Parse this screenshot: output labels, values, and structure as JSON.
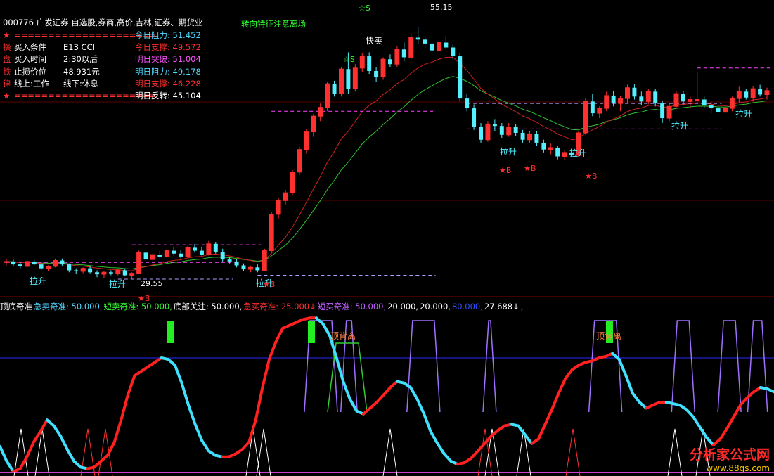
{
  "header": {
    "code": "000776",
    "name": "广发证券",
    "tags": "自选股,券商,高价,吉林,证券、期货业",
    "hint": "转向特征注意离场"
  },
  "info_panel": {
    "rows": [
      {
        "mark": "★",
        "label": "=====================",
        "key": "今日阻力:",
        "value": "51.452",
        "key_color": "#4fd8ff",
        "val_color": "#4fd8ff"
      },
      {
        "mark": "操",
        "label": "买入条件",
        "mid": "E13 CCI",
        "key": "今日支撑:",
        "value": "49.572",
        "key_color": "#ff3030",
        "val_color": "#ff3030"
      },
      {
        "mark": "盘",
        "label": "买入时间",
        "mid": "2:30以后",
        "key": "明日突破:",
        "value": "51.004",
        "key_color": "#ff55ff",
        "val_color": "#ff55ff"
      },
      {
        "mark": "铁",
        "label": "止损价位",
        "mid": "48.931元",
        "key": "明日阻力:",
        "value": "49.178",
        "key_color": "#4fd8ff",
        "val_color": "#4fd8ff"
      },
      {
        "mark": "律",
        "label": "线上:工作",
        "mid": "线下:休息",
        "key": "明日支撑:",
        "value": "46.228",
        "key_color": "#ff3030",
        "val_color": "#ff3030"
      },
      {
        "mark": "★",
        "label": "=====================",
        "key": "明日反转:",
        "value": "45.104",
        "key_color": "#ffffff",
        "val_color": "#ffffff"
      }
    ]
  },
  "annotations": {
    "sell_fast": "快卖",
    "peak_price": "55.15",
    "low_price": "29.55",
    "pull_up": "拉升",
    "buy": "★B",
    "sell": "☆S",
    "top_divergence": "顶背离"
  },
  "indicator_bar": {
    "items": [
      {
        "text": "顶底奇准",
        "color": "#ffffff"
      },
      {
        "text": "急卖奇准: 50.000,",
        "color": "#4fd8ff"
      },
      {
        "text": "短卖奇准: 50.000,",
        "color": "#33ff33"
      },
      {
        "text": "底部关注: 50.000,",
        "color": "#ffffff"
      },
      {
        "text": "急买奇准: 25.000↓",
        "color": "#ff3030"
      },
      {
        "text": "短买奇准: 50.000,",
        "color": "#c060ff"
      },
      {
        "text": "20.000,",
        "color": "#ffffff"
      },
      {
        "text": "20.000,",
        "color": "#ffffff"
      },
      {
        "text": "80.000,",
        "color": "#3050ff"
      },
      {
        "text": "27.688↓",
        "color": "#ffffff"
      },
      {
        "text": ",",
        "color": "#ffffff"
      }
    ]
  },
  "watermark": {
    "title": "分析家公式网",
    "url": "www.88gs.com"
  },
  "colors": {
    "up": "#ff3030",
    "down": "#54f0ff",
    "ma_fast": "#d02020",
    "ma_slow": "#30c030",
    "magenta": "#ff44ff",
    "blue_line": "#2a2aff",
    "osc_red": "#ff2020",
    "osc_cyan": "#40e0ff",
    "green_block": "#22ee22",
    "purple": "#a070ff"
  },
  "chart_data": [
    {
      "type": "candlestick",
      "title": "",
      "ylim": [
        28.0,
        56.5
      ],
      "annotated_high": 55.15,
      "annotated_low": 29.55,
      "series": [
        {
          "ohlc": [
            [
              31.2,
              31.6,
              30.9,
              31.3
            ],
            [
              31.3,
              31.5,
              30.8,
              31.0
            ],
            [
              31.0,
              31.2,
              30.6,
              30.8
            ],
            [
              30.8,
              31.4,
              30.7,
              31.3
            ],
            [
              31.3,
              31.5,
              30.9,
              31.0
            ],
            [
              31.0,
              31.1,
              30.4,
              30.6
            ],
            [
              30.6,
              30.9,
              30.3,
              30.8
            ],
            [
              30.8,
              31.6,
              30.7,
              31.4
            ],
            [
              31.4,
              31.6,
              30.8,
              31.0
            ],
            [
              31.0,
              31.1,
              30.2,
              30.4
            ],
            [
              30.4,
              30.6,
              30.0,
              30.3
            ],
            [
              30.3,
              30.7,
              30.1,
              30.6
            ],
            [
              30.6,
              30.8,
              30.1,
              30.2
            ],
            [
              30.2,
              30.4,
              29.7,
              30.0
            ],
            [
              30.0,
              30.3,
              29.6,
              30.2
            ],
            [
              30.2,
              30.4,
              29.9,
              30.1
            ],
            [
              30.1,
              30.5,
              29.9,
              30.4
            ],
            [
              30.4,
              30.6,
              29.8,
              29.9
            ],
            [
              29.9,
              30.2,
              29.55,
              30.1
            ],
            [
              30.1,
              32.4,
              30.0,
              32.2
            ],
            [
              32.2,
              32.5,
              31.3,
              31.5
            ],
            [
              31.5,
              32.1,
              31.3,
              32.0
            ],
            [
              32.0,
              32.4,
              31.6,
              31.8
            ],
            [
              31.8,
              32.6,
              31.7,
              32.4
            ],
            [
              32.4,
              32.8,
              31.9,
              32.1
            ],
            [
              32.1,
              32.5,
              31.6,
              31.8
            ],
            [
              31.8,
              32.9,
              31.7,
              32.7
            ],
            [
              32.7,
              33.1,
              32.2,
              32.4
            ],
            [
              32.4,
              32.8,
              31.9,
              32.0
            ],
            [
              32.0,
              33.4,
              31.9,
              33.1
            ],
            [
              33.1,
              33.3,
              32.1,
              32.3
            ],
            [
              32.3,
              32.6,
              31.3,
              31.5
            ],
            [
              31.5,
              31.8,
              31.1,
              31.3
            ],
            [
              31.3,
              31.5,
              30.7,
              30.9
            ],
            [
              30.9,
              31.1,
              30.3,
              30.5
            ],
            [
              30.5,
              30.8,
              30.2,
              30.7
            ],
            [
              30.7,
              31.0,
              30.2,
              30.4
            ],
            [
              30.4,
              32.6,
              30.3,
              32.4
            ],
            [
              32.4,
              36.3,
              32.2,
              36.1
            ],
            [
              36.1,
              37.8,
              35.7,
              37.5
            ],
            [
              37.5,
              38.6,
              37.1,
              38.3
            ],
            [
              38.3,
              40.6,
              38.0,
              40.4
            ],
            [
              40.4,
              43.0,
              40.1,
              42.7
            ],
            [
              42.7,
              44.8,
              42.3,
              44.5
            ],
            [
              44.5,
              46.3,
              44.0,
              46.1
            ],
            [
              46.1,
              47.4,
              45.6,
              47.0
            ],
            [
              47.0,
              49.6,
              46.6,
              49.4
            ],
            [
              49.4,
              49.7,
              48.1,
              48.4
            ],
            [
              48.4,
              51.1,
              48.1,
              50.9
            ],
            [
              50.9,
              52.6,
              48.4,
              48.9
            ],
            [
              48.9,
              51.4,
              48.6,
              51.0
            ],
            [
              51.0,
              52.5,
              50.6,
              52.2
            ],
            [
              52.2,
              52.6,
              50.4,
              50.7
            ],
            [
              50.7,
              51.1,
              49.6,
              50.1
            ],
            [
              50.1,
              52.1,
              49.8,
              51.9
            ],
            [
              51.9,
              52.4,
              51.1,
              51.4
            ],
            [
              51.4,
              53.2,
              51.1,
              52.9
            ],
            [
              52.9,
              53.6,
              51.7,
              52.1
            ],
            [
              52.1,
              54.4,
              51.9,
              54.1
            ],
            [
              54.1,
              55.15,
              53.4,
              53.9
            ],
            [
              53.9,
              54.2,
              53.1,
              53.5
            ],
            [
              53.5,
              53.8,
              52.4,
              52.8
            ],
            [
              52.8,
              54.1,
              52.5,
              53.6
            ],
            [
              53.6,
              54.3,
              52.9,
              53.1
            ],
            [
              53.1,
              53.4,
              51.9,
              52.2
            ],
            [
              52.2,
              52.5,
              47.6,
              47.9
            ],
            [
              47.9,
              48.4,
              46.6,
              46.9
            ],
            [
              46.9,
              47.3,
              44.7,
              45.0
            ],
            [
              45.0,
              45.4,
              43.4,
              43.7
            ],
            [
              43.7,
              45.6,
              43.5,
              45.3
            ],
            [
              45.3,
              45.8,
              44.6,
              45.1
            ],
            [
              45.1,
              45.4,
              43.9,
              44.2
            ],
            [
              44.2,
              45.4,
              44.0,
              45.0
            ],
            [
              45.0,
              45.3,
              44.1,
              44.4
            ],
            [
              44.4,
              44.7,
              43.4,
              43.7
            ],
            [
              43.7,
              44.6,
              43.4,
              44.3
            ],
            [
              44.3,
              44.6,
              43.1,
              43.4
            ],
            [
              43.4,
              43.7,
              42.4,
              42.7
            ],
            [
              42.7,
              43.3,
              42.2,
              42.9
            ],
            [
              42.9,
              43.1,
              41.7,
              42.0
            ],
            [
              42.0,
              42.6,
              41.6,
              42.4
            ],
            [
              42.4,
              42.8,
              41.9,
              42.1
            ],
            [
              42.1,
              44.6,
              41.9,
              44.4
            ],
            [
              44.4,
              47.9,
              44.2,
              47.6
            ],
            [
              47.6,
              48.4,
              46.1,
              46.4
            ],
            [
              46.4,
              47.1,
              45.9,
              46.9
            ],
            [
              46.9,
              48.6,
              46.6,
              48.2
            ],
            [
              48.2,
              48.7,
              47.1,
              47.4
            ],
            [
              47.4,
              48.2,
              46.6,
              47.9
            ],
            [
              47.9,
              49.3,
              47.4,
              49.0
            ],
            [
              49.0,
              49.4,
              47.8,
              48.1
            ],
            [
              48.1,
              48.6,
              47.2,
              47.6
            ],
            [
              47.6,
              48.9,
              47.3,
              48.6
            ],
            [
              48.6,
              48.9,
              47.1,
              47.4
            ],
            [
              47.4,
              47.7,
              45.4,
              45.9
            ],
            [
              45.9,
              47.4,
              45.6,
              47.1
            ],
            [
              47.1,
              48.6,
              46.9,
              48.4
            ],
            [
              48.4,
              48.7,
              47.2,
              47.6
            ],
            [
              47.6,
              48.1,
              47.0,
              47.8
            ],
            [
              47.8,
              50.6,
              47.5,
              47.8
            ],
            [
              47.8,
              48.2,
              46.9,
              47.2
            ],
            [
              47.2,
              47.6,
              46.4,
              46.9
            ],
            [
              46.9,
              47.3,
              46.1,
              46.5
            ],
            [
              46.5,
              47.1,
              46.2,
              46.9
            ],
            [
              46.9,
              48.1,
              46.6,
              47.9
            ],
            [
              47.9,
              49.1,
              47.4,
              48.6
            ],
            [
              48.6,
              48.9,
              47.8,
              48.0
            ],
            [
              48.0,
              49.2,
              47.6,
              48.9
            ],
            [
              48.9,
              49.3,
              48.1,
              48.3
            ],
            [
              48.3,
              49.0,
              47.8,
              48.7
            ]
          ]
        }
      ]
    },
    {
      "type": "line",
      "title": "顶底奇准",
      "ylim": [
        0,
        110
      ],
      "reference_lines": [
        80,
        20
      ],
      "series": [
        {
          "name": "",
          "values": [
            20,
            10,
            3,
            5,
            13,
            23,
            30,
            38,
            34,
            27,
            18,
            10,
            6,
            5,
            6,
            10,
            14,
            23,
            38,
            55,
            68,
            71,
            74,
            77,
            80,
            79,
            75,
            63,
            48,
            35,
            24,
            17,
            14,
            13,
            13,
            15,
            18,
            23,
            38,
            60,
            79,
            91,
            100,
            102,
            104,
            106,
            107,
            107,
            103,
            95,
            80,
            64,
            52,
            44,
            42,
            46,
            50,
            55,
            60,
            64,
            63,
            60,
            52,
            42,
            30,
            22,
            15,
            10,
            8,
            9,
            12,
            17,
            22,
            27,
            31,
            34,
            35,
            34,
            28,
            22,
            25,
            35,
            45,
            56,
            66,
            72,
            75,
            77,
            78,
            80,
            81,
            83,
            79,
            68,
            56,
            50,
            46,
            48,
            50,
            50,
            49,
            48,
            45,
            40,
            33,
            26,
            21,
            25,
            32,
            40,
            48,
            53,
            57,
            60,
            59,
            57
          ]
        }
      ]
    }
  ]
}
